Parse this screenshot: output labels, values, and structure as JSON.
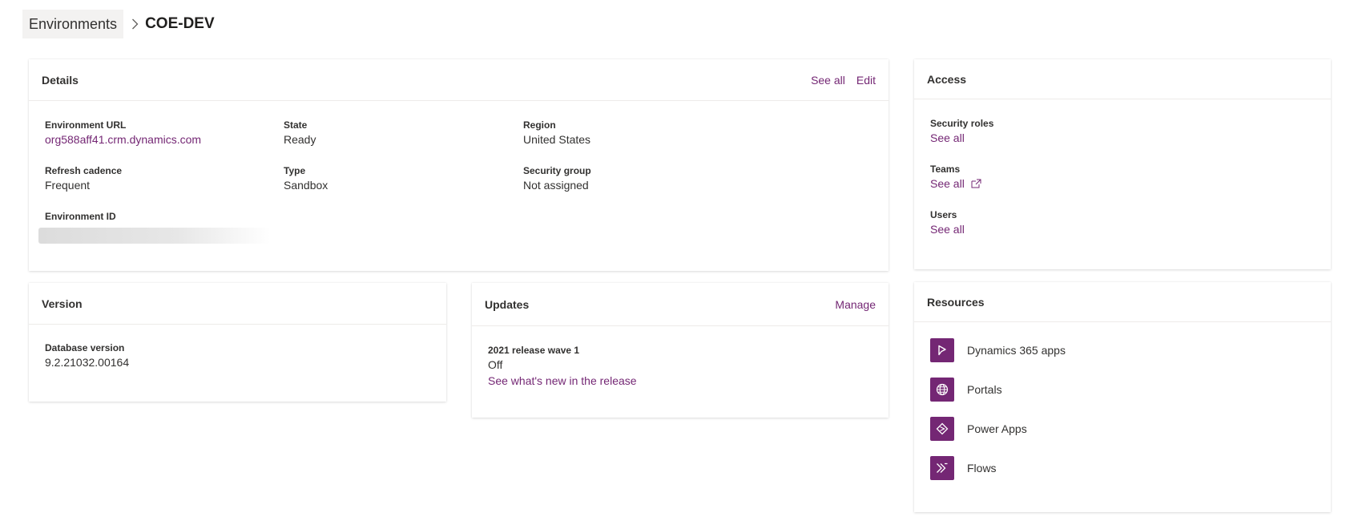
{
  "breadcrumb": {
    "parent": "Environments",
    "current": "COE-DEV"
  },
  "details": {
    "title": "Details",
    "actions": {
      "see_all": "See all",
      "edit": "Edit"
    },
    "fields": {
      "env_url": {
        "label": "Environment URL",
        "value": "org588aff41.crm.dynamics.com"
      },
      "state": {
        "label": "State",
        "value": "Ready"
      },
      "region": {
        "label": "Region",
        "value": "United States"
      },
      "refresh": {
        "label": "Refresh cadence",
        "value": "Frequent"
      },
      "type": {
        "label": "Type",
        "value": "Sandbox"
      },
      "security_group": {
        "label": "Security group",
        "value": "Not assigned"
      },
      "env_id": {
        "label": "Environment ID"
      }
    }
  },
  "version": {
    "title": "Version",
    "db_label": "Database version",
    "db_value": "9.2.21032.00164"
  },
  "updates": {
    "title": "Updates",
    "manage": "Manage",
    "wave_label": "2021 release wave 1",
    "wave_value": "Off",
    "whats_new": "See what's new in the release"
  },
  "access": {
    "title": "Access",
    "security_roles": {
      "label": "Security roles",
      "link": "See all"
    },
    "teams": {
      "label": "Teams",
      "link": "See all"
    },
    "users": {
      "label": "Users",
      "link": "See all"
    }
  },
  "resources": {
    "title": "Resources",
    "items": [
      {
        "label": "Dynamics 365 apps",
        "icon": "dynamics-365-icon"
      },
      {
        "label": "Portals",
        "icon": "globe-icon"
      },
      {
        "label": "Power Apps",
        "icon": "power-apps-icon"
      },
      {
        "label": "Flows",
        "icon": "flows-icon"
      }
    ]
  },
  "colors": {
    "accent": "#742774",
    "text": "#323130",
    "border": "#edebe9"
  }
}
